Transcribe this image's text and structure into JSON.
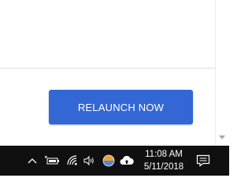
{
  "dialog": {
    "relaunch_button_label": "RELAUNCH NOW",
    "accent_color": "#3367d6"
  },
  "taskbar": {
    "tray_icons": [
      "chevron-up-icon",
      "battery-icon",
      "wifi-icon",
      "volume-icon",
      "chrome-profile-icon",
      "cloud-upload-icon"
    ],
    "clock": {
      "time": "11:08 AM",
      "date": "5/11/2018"
    },
    "action_center_icon": "notification-icon"
  }
}
